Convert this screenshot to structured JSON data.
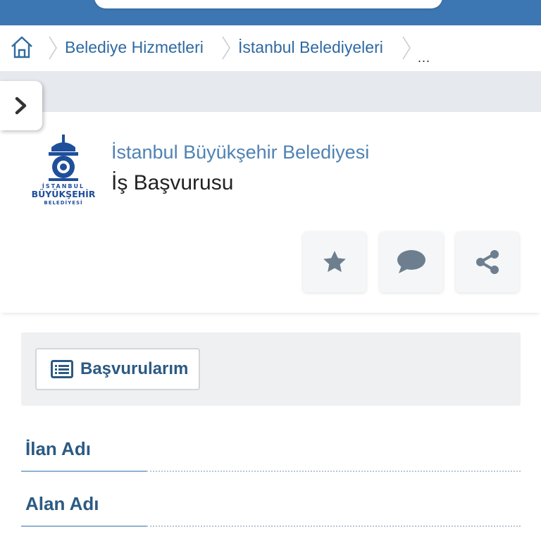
{
  "breadcrumb": {
    "items": [
      "Belediye Hizmetleri",
      "İstanbul Belediyeleri"
    ],
    "more": "..."
  },
  "header": {
    "org_name": "İstanbul Büyükşehir Belediyesi",
    "service_title": "İş Başvurusu",
    "logo_text": [
      "İSTANBUL",
      "BÜYÜKŞEHİR",
      "BELEDİYESİ"
    ]
  },
  "actions": {
    "favorite_icon": "star-icon",
    "comment_icon": "comment-icon",
    "share_icon": "share-icon"
  },
  "panel": {
    "button_label": "Başvurularım",
    "button_icon": "list-icon"
  },
  "fields": [
    {
      "label": "İlan Adı"
    },
    {
      "label": "Alan Adı"
    }
  ],
  "colors": {
    "topbar": "#3d77b3",
    "link": "#2f6aa1",
    "accent": "#2c5a83",
    "icon_gray": "#6d7f8e"
  }
}
